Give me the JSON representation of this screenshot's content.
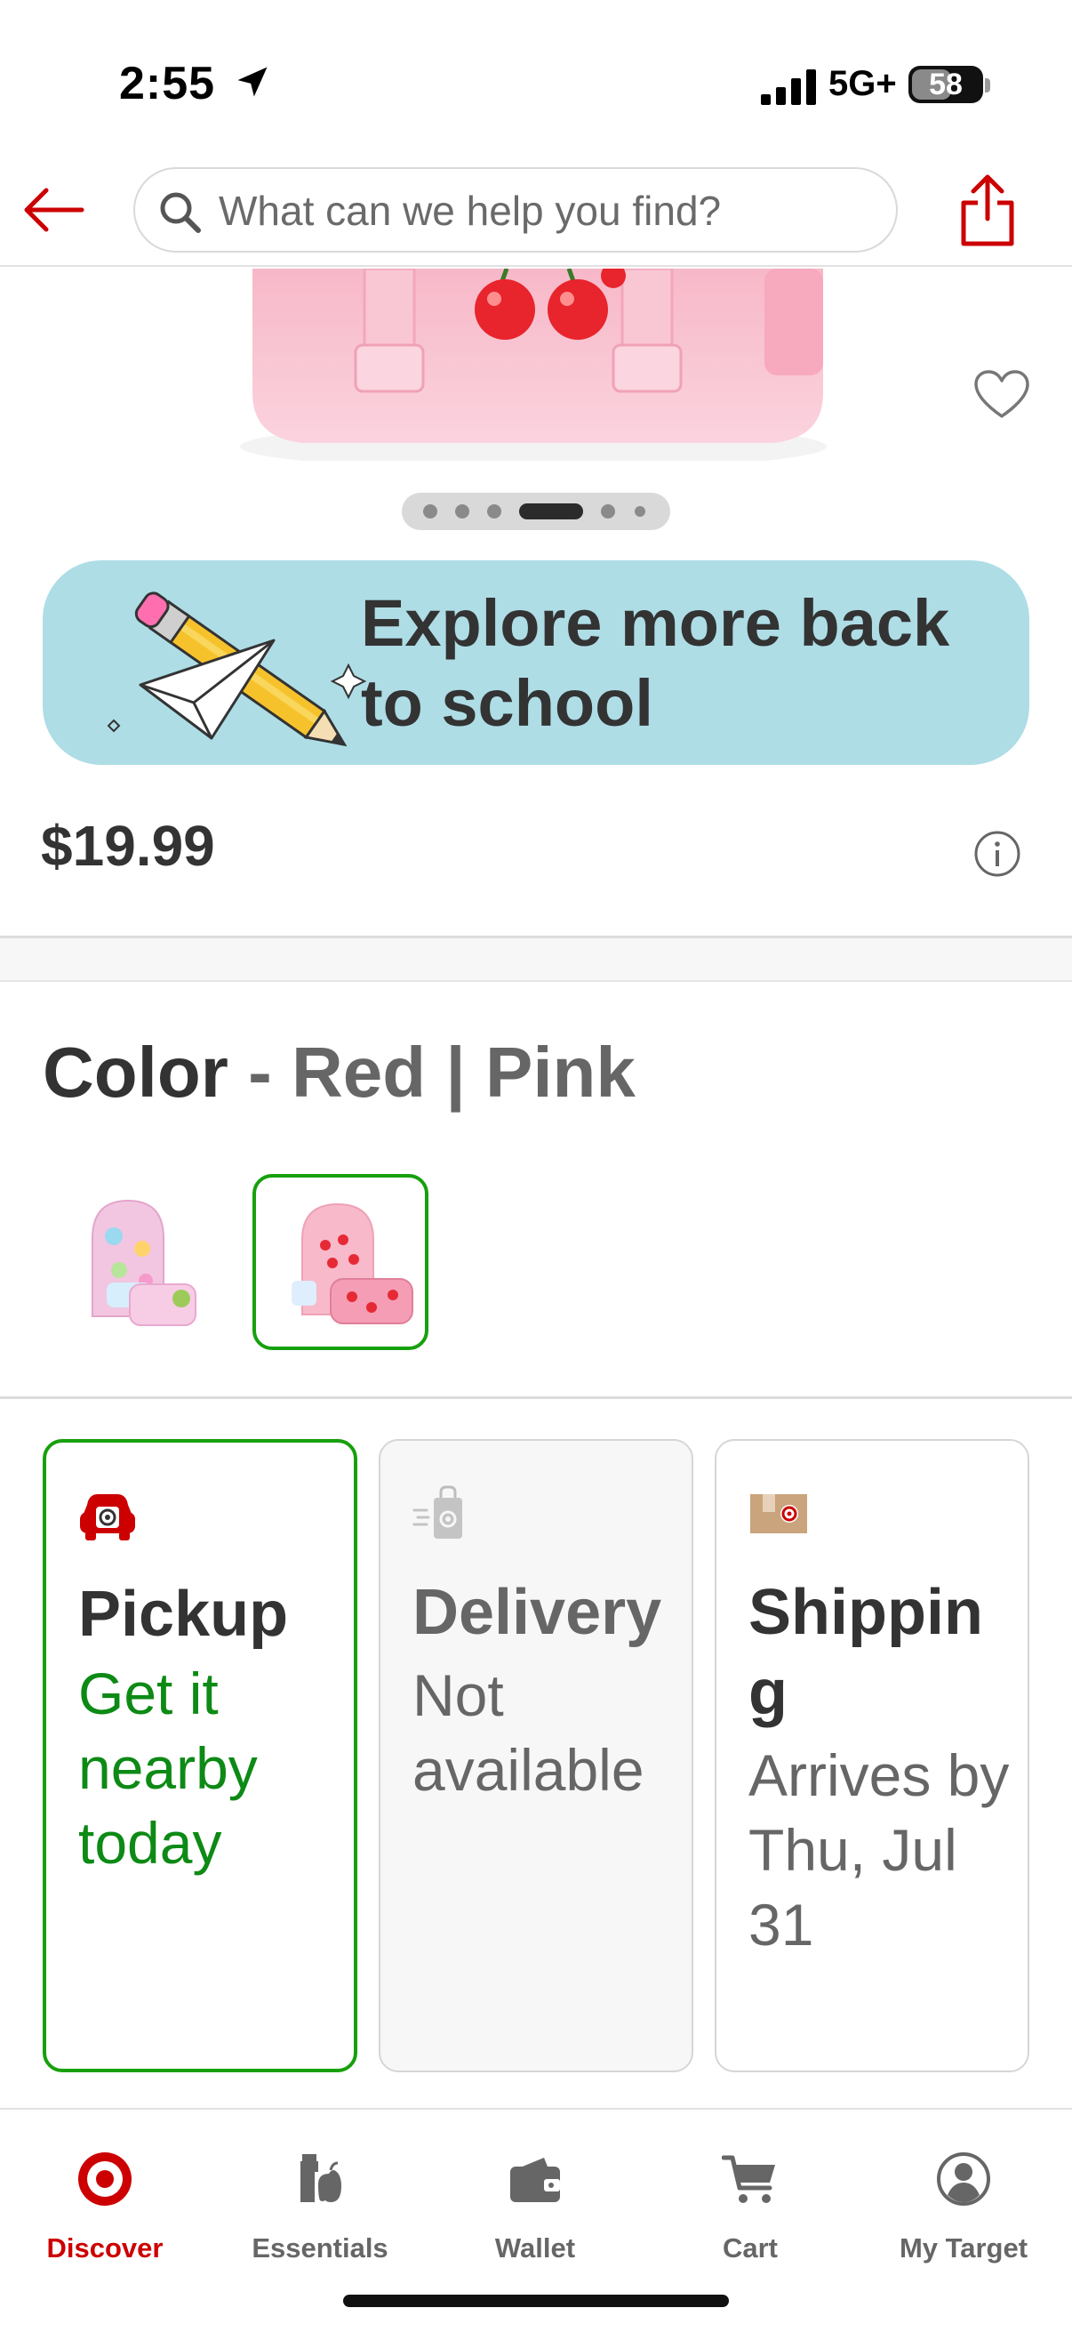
{
  "status_bar": {
    "time": "2:55",
    "network": "5G+",
    "battery_percent": "58",
    "battery_level": 0.58
  },
  "header": {
    "search_placeholder": "What can we help you find?",
    "back_icon": "back-arrow-icon",
    "share_icon": "share-icon"
  },
  "product": {
    "price": "$19.99",
    "carousel": {
      "total": 6,
      "active_index": 3
    }
  },
  "banner": {
    "text": "Explore more back to school"
  },
  "color": {
    "label": "Color",
    "separator": "-",
    "value": "Red | Pink",
    "swatches": [
      {
        "name": "multicolor-backpack-set",
        "selected": false
      },
      {
        "name": "red-pink-backpack-set",
        "selected": true
      }
    ]
  },
  "fulfillment": {
    "pickup": {
      "title": "Pickup",
      "subtitle": "Get it nearby today"
    },
    "delivery": {
      "title": "Delivery",
      "subtitle": "Not available"
    },
    "shipping": {
      "title": "Shipping",
      "subtitle": "Arrives by Thu, Jul 31"
    }
  },
  "tabs": [
    {
      "label": "Discover",
      "icon": "target-logo-icon",
      "active": true
    },
    {
      "label": "Essentials",
      "icon": "essentials-icon",
      "active": false
    },
    {
      "label": "Wallet",
      "icon": "wallet-icon",
      "active": false
    },
    {
      "label": "Cart",
      "icon": "cart-icon",
      "active": false
    },
    {
      "label": "My Target",
      "icon": "account-icon",
      "active": false
    }
  ],
  "colors": {
    "brand_red": "#cc0000",
    "selected_green": "#17a00d",
    "banner_bg": "#aedde6",
    "pickup_green": "#0d8a15"
  }
}
